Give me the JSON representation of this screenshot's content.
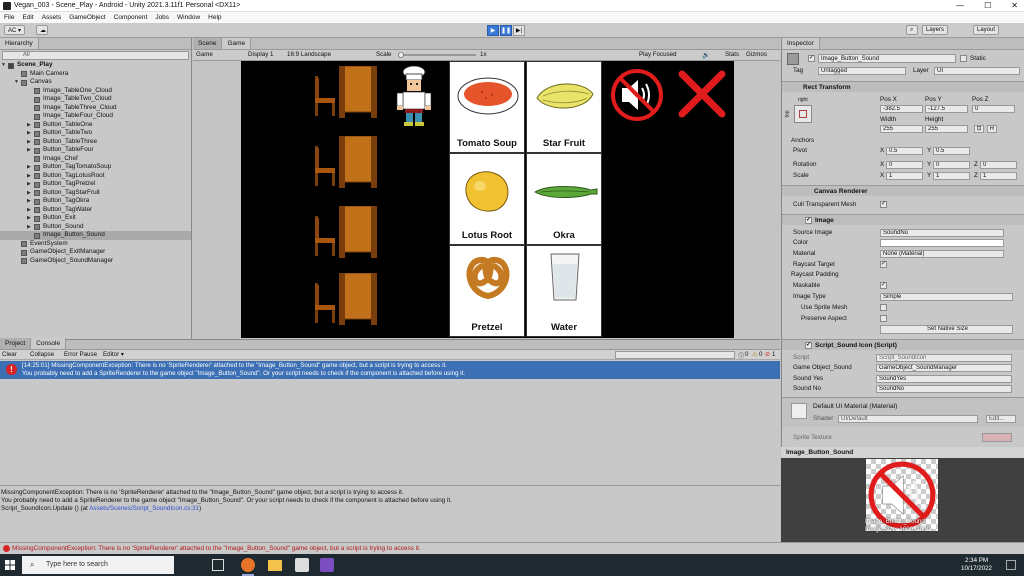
{
  "window": {
    "title": "Vegan_003 - Scene_Play - Android - Unity 2021.3.11f1 Personal <DX11>",
    "min": "—",
    "max": "☐",
    "close": "✕"
  },
  "menu": [
    "File",
    "Edit",
    "Assets",
    "GameObject",
    "Component",
    "Jobs",
    "Window",
    "Help"
  ],
  "toolbar": {
    "account": "AC ▾",
    "layers": "Layers",
    "layout": "Layout"
  },
  "hierarchy": {
    "tab": "Hierarchy",
    "search_placeholder": "All",
    "items": [
      {
        "name": "Scene_Play",
        "indent": 0,
        "arrow": "▼",
        "type": "scene"
      },
      {
        "name": "Main Camera",
        "indent": 1,
        "arrow": "",
        "type": "obj"
      },
      {
        "name": "Canvas",
        "indent": 1,
        "arrow": "▼",
        "type": "obj"
      },
      {
        "name": "Image_TableOne_Cloud",
        "indent": 2,
        "arrow": "",
        "type": "obj"
      },
      {
        "name": "Image_TableTwo_Cloud",
        "indent": 2,
        "arrow": "",
        "type": "obj"
      },
      {
        "name": "Image_TableThree_Cloud",
        "indent": 2,
        "arrow": "",
        "type": "obj"
      },
      {
        "name": "Image_TableFour_Cloud",
        "indent": 2,
        "arrow": "",
        "type": "obj"
      },
      {
        "name": "Button_TableOne",
        "indent": 2,
        "arrow": "▶",
        "type": "obj"
      },
      {
        "name": "Button_TableTwo",
        "indent": 2,
        "arrow": "▶",
        "type": "obj"
      },
      {
        "name": "Button_TableThree",
        "indent": 2,
        "arrow": "▶",
        "type": "obj"
      },
      {
        "name": "Button_TableFour",
        "indent": 2,
        "arrow": "▶",
        "type": "obj"
      },
      {
        "name": "Image_Chef",
        "indent": 2,
        "arrow": "",
        "type": "obj"
      },
      {
        "name": "Button_TagTomatoSoup",
        "indent": 2,
        "arrow": "▶",
        "type": "obj"
      },
      {
        "name": "Button_TagLotusRoot",
        "indent": 2,
        "arrow": "▶",
        "type": "obj"
      },
      {
        "name": "Button_TagPretzel",
        "indent": 2,
        "arrow": "▶",
        "type": "obj"
      },
      {
        "name": "Button_TagStarFruit",
        "indent": 2,
        "arrow": "▶",
        "type": "obj"
      },
      {
        "name": "Button_TagOkra",
        "indent": 2,
        "arrow": "▶",
        "type": "obj"
      },
      {
        "name": "Button_TagWater",
        "indent": 2,
        "arrow": "▶",
        "type": "obj"
      },
      {
        "name": "Button_Exit",
        "indent": 2,
        "arrow": "▶",
        "type": "obj"
      },
      {
        "name": "Button_Sound",
        "indent": 2,
        "arrow": "▶",
        "type": "obj"
      },
      {
        "name": "Image_Button_Sound",
        "indent": 2,
        "arrow": "",
        "type": "obj",
        "selected": true
      },
      {
        "name": "EventSystem",
        "indent": 1,
        "arrow": "",
        "type": "obj"
      },
      {
        "name": "GameObject_ExitManager",
        "indent": 1,
        "arrow": "",
        "type": "obj"
      },
      {
        "name": "GameObject_SoundManager",
        "indent": 1,
        "arrow": "",
        "type": "obj"
      }
    ]
  },
  "scene": {
    "tab_scene": "Scene",
    "tab_game": "Game",
    "game_dropdown": "Game",
    "display": "Display 1",
    "aspect": "16:9 Landscape",
    "scale_label": "Scale",
    "scale_value": "1x",
    "play_focused": "Play Focused",
    "stats": "Stats",
    "gizmos": "Gizmos"
  },
  "game": {
    "tiles": [
      "Tomato Soup",
      "Star Fruit",
      "Lotus Root",
      "Okra",
      "Pretzel",
      "Water"
    ]
  },
  "console": {
    "tab_project": "Project",
    "tab_console": "Console",
    "clear": "Clear",
    "collapse": "Collapse",
    "error_pause": "Error Pause",
    "editor": "Editor ▾",
    "count_log": "0",
    "count_warn": "0",
    "count_err": "1",
    "error_line1": "[14:25:01] MissingComponentException: There is no 'SpriteRenderer' attached to the \"Image_Button_Sound\" game object, but a script is trying to access it.",
    "error_line2": "You probably need to add a SpriteRenderer to the game object \"Image_Button_Sound\". Or your script needs to check if the component is attached before using it.",
    "detail1": "MissingComponentException: There is no 'SpriteRenderer' attached to the \"Image_Button_Sound\" game object, but a script is trying to access it.",
    "detail2": "You probably need to add a SpriteRenderer to the game object \"Image_Button_Sound\". Or your script needs to check if the component is attached before using it.",
    "detail3_prefix": "Script_SoundIcon.Update () (at ",
    "detail3_link": "Assets/Scenes/Script_SoundIcon.cs:31",
    "detail3_suffix": ")"
  },
  "status": {
    "message": "MissingComponentException: There is no 'SpriteRenderer' attached to the \"Image_Button_Sound\" game object, but a script is trying to access it."
  },
  "inspector": {
    "tab": "Inspector",
    "object_name": "Image_Button_Sound",
    "static": "Static",
    "tag_label": "Tag",
    "tag": "Untagged",
    "layer_label": "Layer",
    "layer": "UI",
    "rect": {
      "title": "Rect Transform",
      "anchor_h": "right",
      "anchor_v": "top",
      "posx_l": "Pos X",
      "posy_l": "Pos Y",
      "posz_l": "Pos Z",
      "posx": "-382.5",
      "posy": "-127.5",
      "posz": "0",
      "width_l": "Width",
      "height_l": "Height",
      "width": "255",
      "height": "255",
      "r": "R",
      "anchors": "Anchors",
      "pivot": "Pivot",
      "pivot_x": "0.5",
      "pivot_y": "0.5",
      "rotation": "Rotation",
      "rot_x": "0",
      "rot_y": "0",
      "rot_z": "0",
      "scale": "Scale",
      "sc_x": "1",
      "sc_y": "1",
      "sc_z": "1",
      "x": "X",
      "y": "Y",
      "z": "Z"
    },
    "canvas_renderer": {
      "title": "Canvas Renderer",
      "cull": "Cull Transparent Mesh"
    },
    "image": {
      "title": "Image",
      "source_image_l": "Source Image",
      "source_image": "SoundNo",
      "color_l": "Color",
      "material_l": "Material",
      "material": "None (Material)",
      "raycast_target": "Raycast Target",
      "raycast_padding": "Raycast Padding",
      "maskable": "Maskable",
      "image_type_l": "Image Type",
      "image_type": "Simple",
      "use_sprite_mesh": "Use Sprite Mesh",
      "preserve_aspect": "Preserve Aspect",
      "set_native": "Set Native Size"
    },
    "script": {
      "title": "Script_Sound Icon (Script)",
      "script_l": "Script",
      "script": "Script_SoundIcon",
      "go_l": "Game Object_Sound",
      "go": "GameObject_SoundManager",
      "yes_l": "Sound Yes",
      "yes": "SoundYes",
      "no_l": "Sound No",
      "no": "SoundNo"
    },
    "material": {
      "title": "Default UI Material (Material)",
      "shader_l": "Shader",
      "shader": "UI/Default",
      "edit": "Edit..."
    },
    "sprite_texture": "Sprite Texture"
  },
  "preview": {
    "title": "Image_Button_Sound",
    "caption1": "Image_Button_Sound",
    "caption2": "Image Size: 1000x1000"
  },
  "taskbar": {
    "search": "Type here to search",
    "time": "2:34 PM",
    "date": "10/17/2022"
  },
  "colors": {
    "accent": "#3a79d8",
    "error": "#d92424",
    "console_sel": "#3c6fb4"
  }
}
